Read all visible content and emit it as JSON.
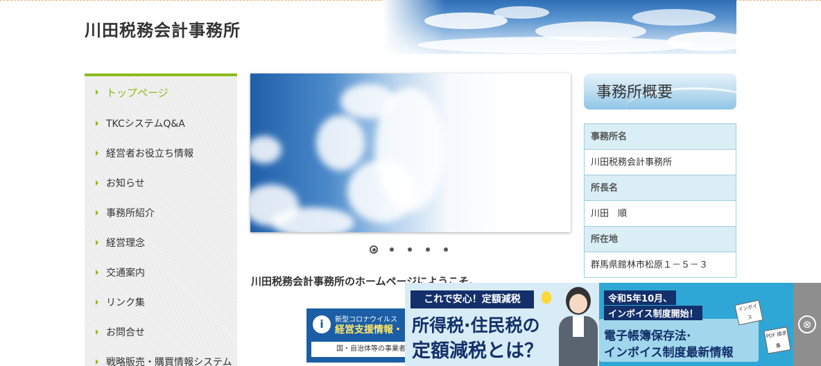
{
  "site": {
    "title": "川田税務会計事務所"
  },
  "nav": {
    "items": [
      {
        "label": "トップページ",
        "active": true
      },
      {
        "label": "TKCシステムQ&A"
      },
      {
        "label": "経営者お役立ち情報"
      },
      {
        "label": "お知らせ"
      },
      {
        "label": "事務所紹介"
      },
      {
        "label": "経営理念"
      },
      {
        "label": "交通案内"
      },
      {
        "label": "リンク集"
      },
      {
        "label": "お問合せ"
      },
      {
        "label": "戦略販売・購買情報システム"
      }
    ]
  },
  "slider": {
    "dot_count": 5,
    "active_index": 0
  },
  "main": {
    "welcome": "川田税務会計事務所のホームページにようこそ。",
    "banner": {
      "icon": "i",
      "line1": "新型コロナウイルス",
      "line2": "経営支援情報・",
      "line3": "国・自治体等の事業者"
    }
  },
  "overview": {
    "title": "事務所概要",
    "rows": [
      {
        "label": "事務所名",
        "value": "川田税務会計事務所"
      },
      {
        "label": "所長名",
        "value": "川田　順"
      },
      {
        "label": "所在地",
        "value": "群馬県館林市松原１－５－３"
      }
    ]
  },
  "ad": {
    "badge": "これで安心！定額減税",
    "headline1": "所得税·住民税の",
    "headline2": "定額減税とは？",
    "right_line1": "令和5年10月、",
    "right_line2": "インボイス制度開始！",
    "right_line3": "電子帳簿保存法·",
    "right_line4": "インボイス制度最新情報",
    "doc1": "インボイス",
    "doc2": "PDF 請求書",
    "close_icon": "⊗"
  },
  "colors": {
    "accent_green": "#8cba1e",
    "table_border": "#9fcfde",
    "table_header_bg": "#d9eef5",
    "ad_navy": "#14306a"
  }
}
